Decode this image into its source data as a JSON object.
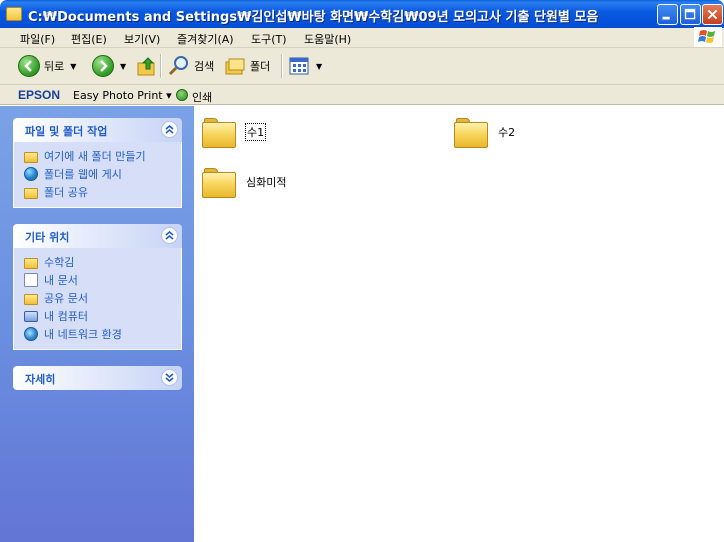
{
  "window": {
    "title": "C:₩Documents and Settings₩김인섭₩바탕 화면₩수학김₩09년 모의고사 기출 단원별 모음"
  },
  "menu": {
    "items": [
      "파일(F)",
      "편집(E)",
      "보기(V)",
      "즐겨찾기(A)",
      "도구(T)",
      "도움말(H)"
    ]
  },
  "toolbar": {
    "back_label": "뒤로",
    "search_label": "검색",
    "folders_label": "폴더"
  },
  "epson": {
    "brand": "EPSON",
    "product": "Easy Photo Print",
    "print_label": "인쇄"
  },
  "sidebar": {
    "tasks": {
      "title": "파일 및 폴더 작업",
      "items": [
        "여기에 새 폴더 만들기",
        "폴더를 웹에 게시",
        "폴더 공유"
      ]
    },
    "places": {
      "title": "기타 위치",
      "items": [
        "수학김",
        "내 문서",
        "공유 문서",
        "내 컴퓨터",
        "내 네트워크 환경"
      ]
    },
    "details": {
      "title": "자세히"
    }
  },
  "files": [
    "수1",
    "수2",
    "심화미적"
  ],
  "colors": {
    "titlebar": "#0450d6",
    "sidebar_link": "#215dc6",
    "sidebar_bg": "#6a8fe0",
    "folder": "#f8d65e"
  }
}
